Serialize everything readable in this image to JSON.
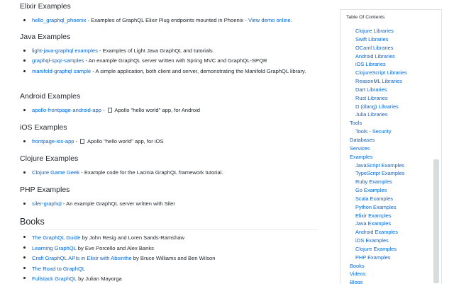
{
  "sections": {
    "elixir": {
      "heading": "Elixir Examples",
      "items": [
        {
          "link": "hello_graphql_phoenix",
          "text": " - Examples of GraphQL Elixir Plug endpoints mounted in Phoenix - ",
          "link2": "View demo online",
          "tail": "."
        }
      ]
    },
    "java": {
      "heading": "Java Examples",
      "items": [
        {
          "link": "light-java-graphql examples",
          "text": " - Examples of Light Java GraphQL and tutorials."
        },
        {
          "link": "graphql-spqr-samples",
          "text": " - An example GraphQL server written with Spring MVC and GraphQL-SPQR"
        },
        {
          "link": "manifold-graphql sample",
          "text": " - A simple application, both client and server, demonstrating the Manifold GraphQL library."
        }
      ]
    },
    "android": {
      "heading": "Android Examples",
      "items": [
        {
          "link": "apollo-frontpage-android-app",
          "pre": " - ",
          "text": " Apollo \"hello world\" app, for Android"
        }
      ]
    },
    "ios": {
      "heading": "iOS Examples",
      "items": [
        {
          "link": "frontpage-ios-app",
          "pre": " - ",
          "text": " Apollo \"hello world\" app, for iOS"
        }
      ]
    },
    "clojure": {
      "heading": "Clojure Examples",
      "items": [
        {
          "link": "Clojure Game Geek",
          "text": " - Example code for the Lacinia GraphQL framework tutorial."
        }
      ]
    },
    "php": {
      "heading": "PHP Examples",
      "items": [
        {
          "link": "siler-graphql",
          "text": " - An example GraphQL server written with Siler"
        }
      ]
    },
    "books": {
      "heading": "Books",
      "items": [
        {
          "link": "The GraphQL Guide",
          "text": " by John Resig and Loren Sands-Ramshaw"
        },
        {
          "link": "Learning GraphQL",
          "text": " by Eve Porcello and Alex Banks"
        },
        {
          "link": "Craft GraphQL APIs in Elixir with Absinthe",
          "text": " by Bruce Williams and Ben Wilson"
        },
        {
          "link": "The Road to GraphQL",
          "text": ""
        },
        {
          "link": "Fullstack GraphQL",
          "text": " by Julian Mayorga"
        }
      ]
    }
  },
  "toc": {
    "title": "Table Of Contents",
    "items": [
      {
        "label": "Clojure Libraries",
        "level": 2
      },
      {
        "label": "Swift Libraries",
        "level": 2
      },
      {
        "label": "OCaml Libraries",
        "level": 2
      },
      {
        "label": "Android Libraries",
        "level": 2
      },
      {
        "label": "iOS Libraries",
        "level": 2
      },
      {
        "label": "ClojureScript Libraries",
        "level": 2
      },
      {
        "label": "ReasonML Libraries",
        "level": 2
      },
      {
        "label": "Dart Libraries",
        "level": 2
      },
      {
        "label": "Rust Libraries",
        "level": 2
      },
      {
        "label": "D (dlang) Libraries",
        "level": 2
      },
      {
        "label": "Julia Libraries",
        "level": 2
      },
      {
        "label": "Tools",
        "level": 1
      },
      {
        "label": "Tools - Security",
        "level": 2
      },
      {
        "label": "Databases",
        "level": 1
      },
      {
        "label": "Services",
        "level": 1
      },
      {
        "label": "Examples",
        "level": 1
      },
      {
        "label": "JavaScript Examples",
        "level": 2
      },
      {
        "label": "TypeScript Examples",
        "level": 2
      },
      {
        "label": "Ruby Examples",
        "level": 2
      },
      {
        "label": "Go Examples",
        "level": 2
      },
      {
        "label": "Scala Examples",
        "level": 2
      },
      {
        "label": "Python Examples",
        "level": 2
      },
      {
        "label": "Elixir Examples",
        "level": 2
      },
      {
        "label": "Java Examples",
        "level": 2
      },
      {
        "label": "Android Examples",
        "level": 2
      },
      {
        "label": "iOS Examples",
        "level": 2
      },
      {
        "label": "Clojure Examples",
        "level": 2
      },
      {
        "label": "PHP Examples",
        "level": 2
      },
      {
        "label": "Books",
        "level": 1
      },
      {
        "label": "Videos",
        "level": 1
      },
      {
        "label": "Blogs",
        "level": 1
      }
    ]
  },
  "colors": {
    "link": "#0366d6",
    "text": "#24292e",
    "rule": "#eaecef"
  },
  "icons": {
    "doc": "document-icon"
  }
}
